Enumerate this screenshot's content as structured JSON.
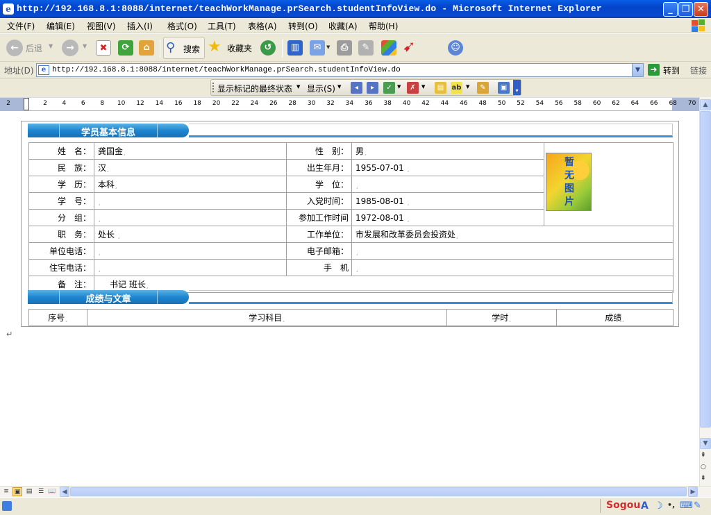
{
  "window": {
    "app_icon": "ie-icon",
    "title": "http://192.168.8.1:8088/internet/teachWorkManage.prSearch.studentInfoView.do - Microsoft Internet Explorer",
    "buttons": [
      "minimize-icon",
      "maximize-icon",
      "close-icon"
    ]
  },
  "menu": [
    "文件(F)",
    "编辑(E)",
    "视图(V)",
    "插入(I)",
    "格式(O)",
    "工具(T)",
    "表格(A)",
    "转到(O)",
    "收藏(A)",
    "帮助(H)"
  ],
  "toolbar": {
    "back_label": "后退",
    "search_label": "搜索",
    "favorites_label": "收藏夹",
    "icons": [
      "back-icon",
      "forward-icon",
      "stop-icon",
      "refresh-icon",
      "home-icon",
      "search-icon",
      "favorites-star-icon",
      "history-icon",
      "research-icon",
      "mail-icon",
      "print-icon",
      "edit-icon",
      "windows-icon",
      "messenger-icon",
      "msn-people-icon"
    ]
  },
  "address": {
    "label": "地址(D)",
    "url": "http://192.168.8.1:8088/internet/teachWorkManage.prSearch.studentInfoView.do",
    "go_label": "转到",
    "links_label": "链接"
  },
  "review_toolbar": {
    "markup_mode": "显示标记的最终状态",
    "show_label": "显示(S)",
    "icons": [
      "prev-change-icon",
      "next-change-icon",
      "accept-change-icon",
      "reject-change-icon",
      "comment-icon",
      "highlight-icon",
      "track-changes-icon",
      "reviewing-pane-icon"
    ]
  },
  "ruler": {
    "ticks": [
      "2",
      "2",
      "4",
      "6",
      "8",
      "10",
      "12",
      "14",
      "16",
      "18",
      "20",
      "22",
      "24",
      "26",
      "28",
      "30",
      "32",
      "34",
      "36",
      "38",
      "40",
      "42",
      "44",
      "46",
      "48",
      "50",
      "52",
      "54",
      "56",
      "58",
      "60",
      "62",
      "64",
      "66",
      "68",
      "70"
    ]
  },
  "document": {
    "section1_title": "学员基本信息",
    "section2_title": "成绩与文章",
    "fields": {
      "name_label": "姓　名：",
      "name_value": "龚国金",
      "gender_label": "性　别：",
      "gender_value": "男",
      "ethnicity_label": "民　族：",
      "ethnicity_value": "汉",
      "birth_label": "出生年月：",
      "birth_value": "1955-07-01",
      "education_label": "学　历：",
      "education_value": "本科",
      "degree_label": "学　位：",
      "degree_value": "",
      "student_no_label": "学　号：",
      "student_no_value": "",
      "party_date_label": "入党时间：",
      "party_date_value": "1985-08-01",
      "group_label": "分　组：",
      "group_value": "",
      "work_start_label": "参加工作时间",
      "work_start_value": "1972-08-01",
      "position_label": "职　务：",
      "position_value": "处长",
      "employer_label": "工作单位：",
      "employer_value": "市发展和改革委员会投资处",
      "work_phone_label": "单位电话：",
      "work_phone_value": "",
      "email_label": "电子邮箱：",
      "email_value": "",
      "home_phone_label": "住宅电话：",
      "home_phone_value": "",
      "mobile_label": "手　机",
      "mobile_value": "",
      "remarks_label": "备　注：",
      "remarks_value": "书记 班长"
    },
    "photo_text": "暂无图片",
    "score_headers": [
      "序号",
      "学习科目",
      "学时",
      "成绩"
    ],
    "cell_mark": "¸",
    "paragraph_mark": "↵"
  },
  "view_buttons": [
    "normal-view-icon",
    "web-view-icon",
    "print-view-icon",
    "outline-view-icon",
    "reading-view-icon"
  ],
  "ime": {
    "brand": "Sogou",
    "icons": [
      "ime-mode-icon",
      "ime-moon-icon",
      "ime-punct-icon",
      "ime-keyboard-icon",
      "ime-settings-icon"
    ]
  }
}
